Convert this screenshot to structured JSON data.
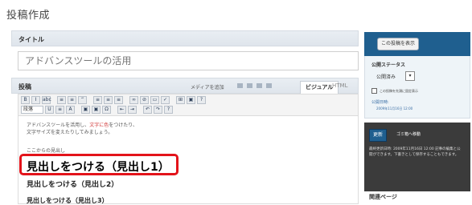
{
  "page": {
    "title": "投稿作成"
  },
  "title_box": {
    "label": "タイトル",
    "value": "アドバンスツールの活用"
  },
  "body_box": {
    "label": "投稿",
    "media_upload": "メディアを追加",
    "tab_visual": "ビジュアル",
    "tab_html": "HTML"
  },
  "toolbar": {
    "row1": [
      "B",
      "I",
      "abc",
      "≡",
      "≡",
      "“",
      "≡",
      "≡",
      "≡",
      "∞",
      "⊘",
      "▭",
      "✓",
      "⊞",
      "▣",
      "?"
    ],
    "row2_select": "段落",
    "row2": [
      "U",
      "≡",
      "A",
      "▣",
      "▣",
      "Ω",
      "⇤",
      "⇥",
      "↶",
      "↷",
      "?"
    ]
  },
  "editor": {
    "line1_prefix": "アドバンスツールを活用し、",
    "line1_red": "文字に色",
    "line1_suffix": "をつけたり、",
    "line2": "文字サイズを変えたりしてみましょう。",
    "line3": "ここからの見出し",
    "heading1": "見出しをつける（見出し1）",
    "heading2": "見出しをつける（見出し2）",
    "heading3": "見出しをつける（見出し3）"
  },
  "sidebar": {
    "preview_button": "この投稿を表示",
    "publish_status_label": "公開ステータス",
    "publish_status_value": "公開済み",
    "stick_checkbox": "この投稿を先頭に固定表示",
    "published_label": "公開日時:",
    "published_time": "2009年11月16日 12:00",
    "update_button": "更新",
    "trash_link": "ゴミ箱へ移動",
    "info_text": "最終更新日時: 2009年11月16日 12:00 記事の編集と公開ができます。下書きとして保存することもできます。",
    "related_label": "関連ページ"
  },
  "colors": {
    "accent": "#1f5f8f",
    "highlight_border": "#e3131a",
    "red_text": "#d23b3b"
  }
}
